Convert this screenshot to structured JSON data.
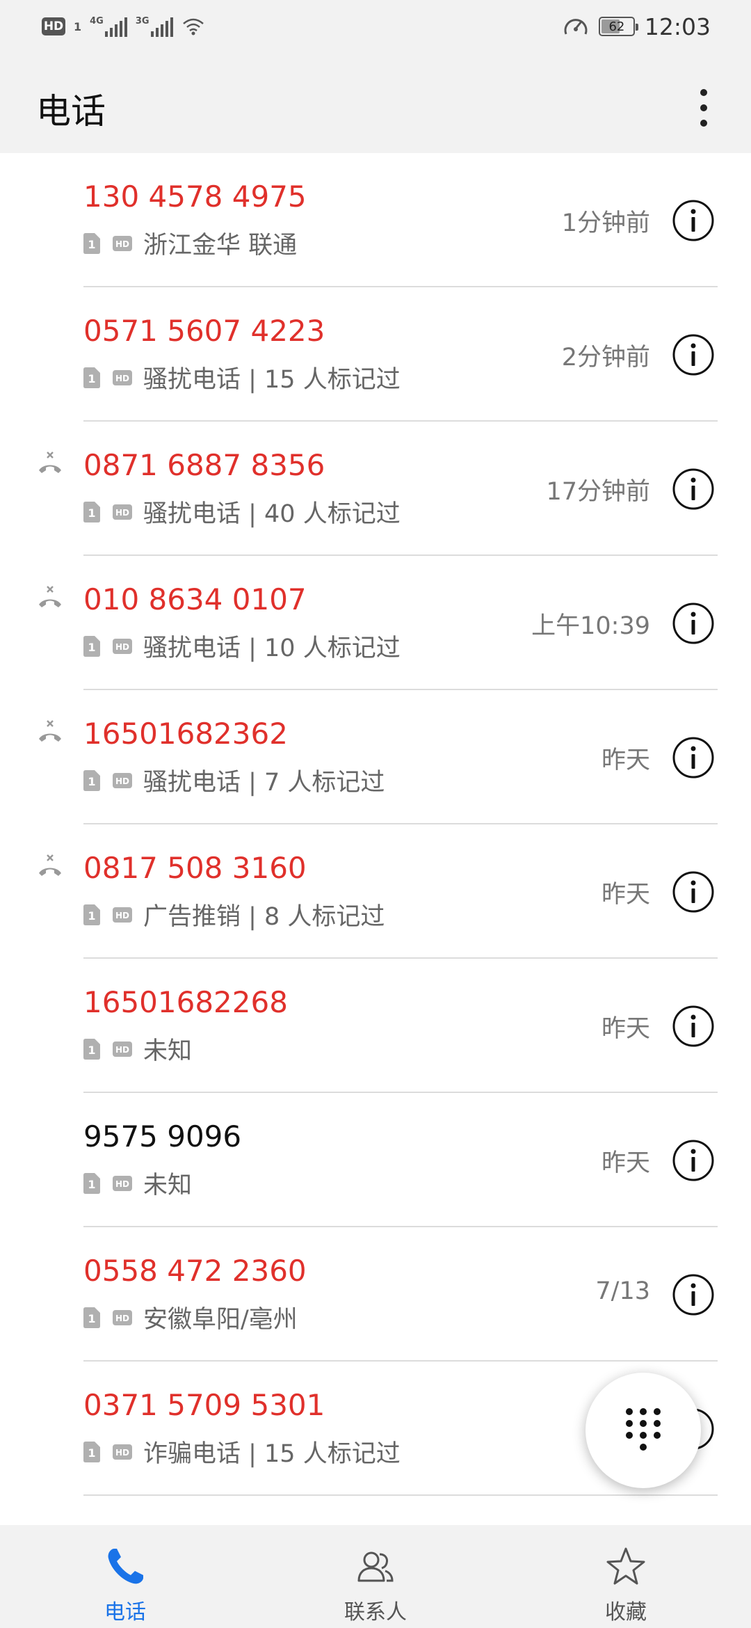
{
  "status_bar": {
    "hd_badge": "HD",
    "sim_number": "1",
    "network1": "4G",
    "network2": "3G",
    "battery": "62",
    "battery_level": 0.62,
    "time": "12:03"
  },
  "app_bar": {
    "title": "电话",
    "more_icon": "more-vertical-icon"
  },
  "calls": [
    {
      "number": "130 4578 4975",
      "missed": false,
      "spam": true,
      "label": "浙江金华 联通",
      "time": "1分钟前"
    },
    {
      "number": "0571 5607 4223",
      "missed": false,
      "spam": true,
      "label": "骚扰电话 | 15 人标记过",
      "time": "2分钟前"
    },
    {
      "number": "0871 6887 8356",
      "missed": true,
      "spam": true,
      "label": "骚扰电话 | 40 人标记过",
      "time": "17分钟前"
    },
    {
      "number": "010 8634 0107",
      "missed": true,
      "spam": true,
      "label": "骚扰电话 | 10 人标记过",
      "time": "上午10:39"
    },
    {
      "number": "16501682362",
      "missed": true,
      "spam": true,
      "label": "骚扰电话 | 7 人标记过",
      "time": "昨天"
    },
    {
      "number": "0817 508 3160",
      "missed": true,
      "spam": true,
      "label": "广告推销 | 8 人标记过",
      "time": "昨天"
    },
    {
      "number": "16501682268",
      "missed": false,
      "spam": true,
      "label": "未知",
      "time": "昨天"
    },
    {
      "number": "9575 9096",
      "missed": false,
      "spam": false,
      "label": "未知",
      "time": "昨天"
    },
    {
      "number": "0558 472 2360",
      "missed": false,
      "spam": true,
      "label": "安徽阜阳/亳州",
      "time": "7/13"
    },
    {
      "number": "0371 5709 5301",
      "missed": false,
      "spam": true,
      "label": "诈骗电话 | 15 人标记过",
      "time": ""
    }
  ],
  "sim_icon_label": "1",
  "hd_icon_label": "HD",
  "fab": {
    "icon": "dialpad-icon"
  },
  "bottom_nav": [
    {
      "label": "电话",
      "icon": "phone-icon",
      "active": true
    },
    {
      "label": "联系人",
      "icon": "contacts-icon",
      "active": false
    },
    {
      "label": "收藏",
      "icon": "star-icon",
      "active": false
    }
  ],
  "colors": {
    "missed_red": "#e0302b",
    "accent_blue": "#1a73e8",
    "bar_bg": "#f2f2f2"
  }
}
